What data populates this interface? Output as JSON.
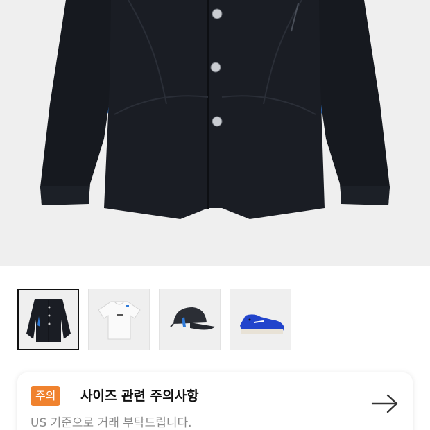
{
  "product": {
    "main_image": "jacket-photo",
    "thumbnails": [
      {
        "name": "jacket",
        "selected": true
      },
      {
        "name": "tshirt",
        "selected": false
      },
      {
        "name": "cap",
        "selected": false
      },
      {
        "name": "sneaker",
        "selected": false
      }
    ]
  },
  "notice": {
    "badge": "주의",
    "title": "사이즈 관련 주의사항",
    "subtitle": "US 기준으로 거래 부탁드립니다.",
    "arrow_icon": "arrow-right-icon",
    "badge_color": "#f0822e"
  }
}
